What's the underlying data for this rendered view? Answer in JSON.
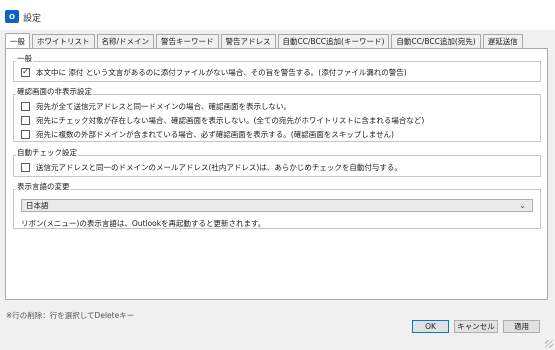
{
  "window": {
    "icon_letter": "O",
    "title": "設定"
  },
  "tabs": [
    {
      "label": "一般",
      "active": true
    },
    {
      "label": "ホワイトリスト"
    },
    {
      "label": "名称/ドメイン"
    },
    {
      "label": "警告キーワード"
    },
    {
      "label": "警告アドレス"
    },
    {
      "label": "自動CC/BCC追加(キーワード)"
    },
    {
      "label": "自動CC/BCC追加(宛先)"
    },
    {
      "label": "遅延送信"
    }
  ],
  "groups": {
    "general": {
      "title": "一般",
      "items": [
        {
          "label": "本文中に 添付 という文言があるのに添付ファイルがない場合、その旨を警告する。(添付ファイル漏れの警告)",
          "checked": true
        }
      ]
    },
    "hide_confirm": {
      "title": "確認画面の非表示設定",
      "items": [
        {
          "label": "宛先が全て送信元アドレスと同一ドメインの場合、確認画面を表示しない。",
          "checked": false
        },
        {
          "label": "宛先にチェック対象が存在しない場合、確認画面を表示しない。(全ての宛先がホワイトリストに含まれる場合など)",
          "checked": false
        },
        {
          "label": "宛先に複数の外部ドメインが含まれている場合、必ず確認画面を表示する。(確認画面をスキップしません)",
          "checked": false
        }
      ]
    },
    "auto_check": {
      "title": "自動チェック設定",
      "items": [
        {
          "label": "送信元アドレスと同一のドメインのメールアドレス(社内アドレス)は、あらかじめチェックを自動付与する。",
          "checked": false
        }
      ]
    },
    "language": {
      "title": "表示言語の変更",
      "selected": "日本語",
      "hint": "リボン(メニュー)の表示言語は、Outlookを再起動すると更新されます。"
    }
  },
  "footnote": "※行の削除：行を選択してDeleteキー",
  "buttons": {
    "ok": "OK",
    "cancel": "キャンセル",
    "apply": "適用"
  },
  "check_mark": "✓"
}
